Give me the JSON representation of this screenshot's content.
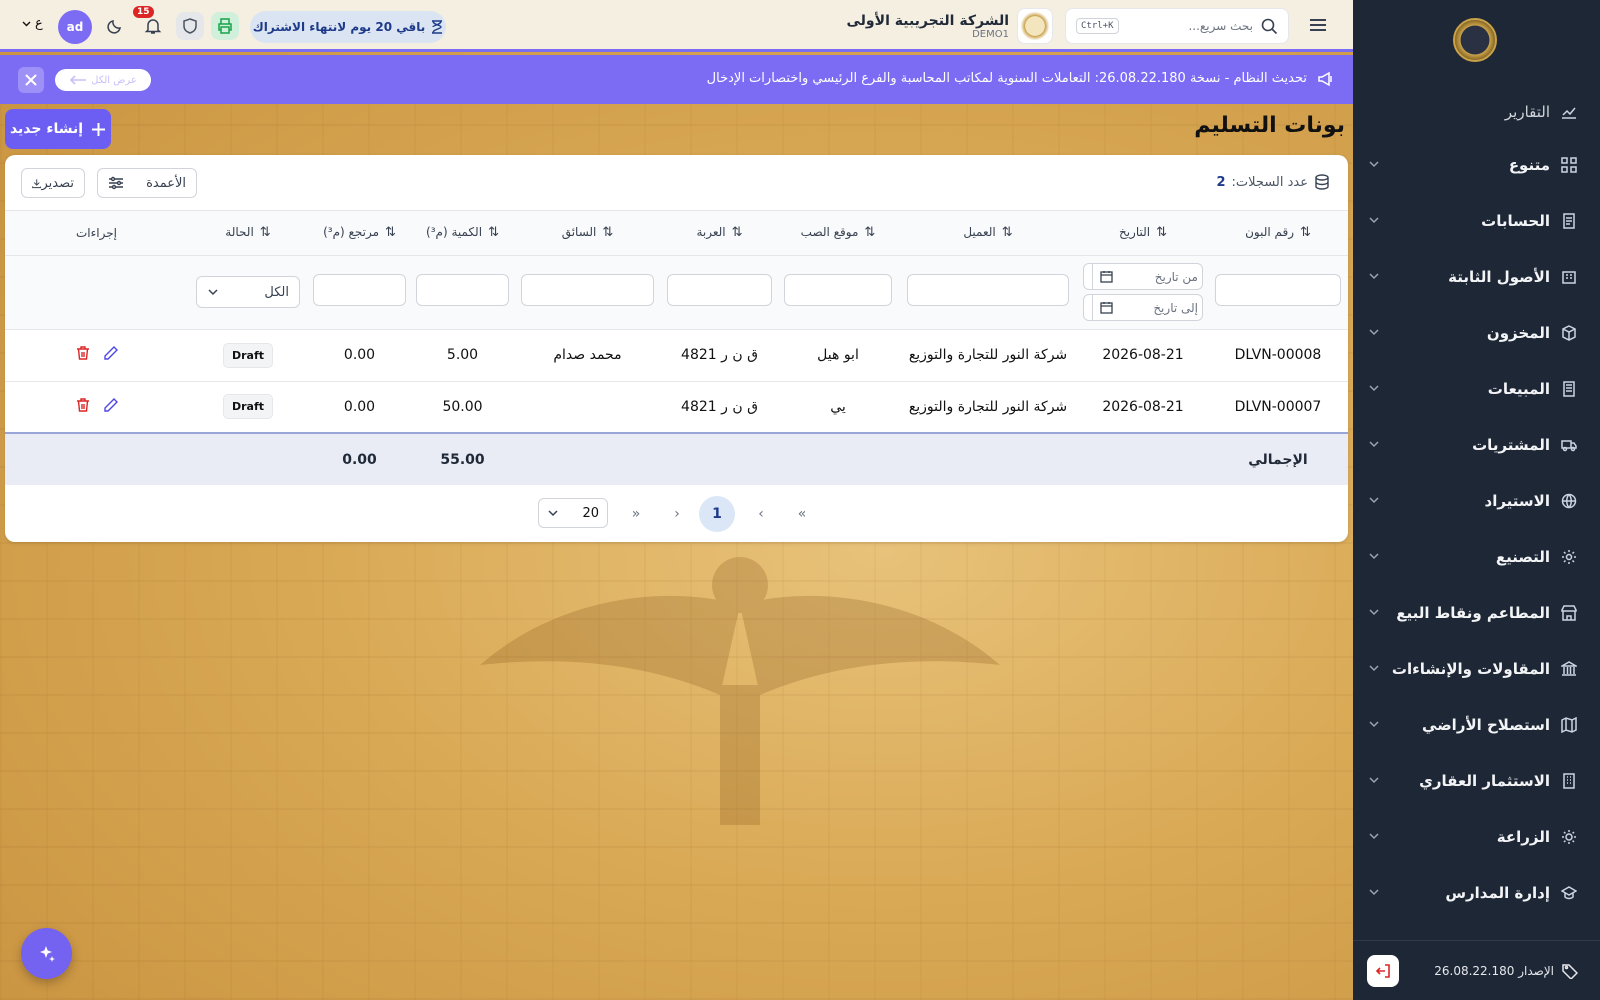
{
  "sidebar": {
    "items": [
      {
        "label": "التقارير",
        "icon": "chart-line-icon"
      },
      {
        "label": "متنوع",
        "icon": "grid-icon"
      },
      {
        "label": "الحسابات",
        "icon": "receipt-icon"
      },
      {
        "label": "الأصول الثابتة",
        "icon": "building-icon"
      },
      {
        "label": "المخزون",
        "icon": "box-icon"
      },
      {
        "label": "المبيعات",
        "icon": "invoice-icon"
      },
      {
        "label": "المشتريات",
        "icon": "truck-icon"
      },
      {
        "label": "الاستيراد",
        "icon": "globe-icon"
      },
      {
        "label": "التصنيع",
        "icon": "gear-icon"
      },
      {
        "label": "المطاعم ونقاط البيع",
        "icon": "store-icon"
      },
      {
        "label": "المقاولات والإنشاءات",
        "icon": "bank-icon"
      },
      {
        "label": "استصلاح الأراضي",
        "icon": "map-icon"
      },
      {
        "label": "الاستثمار العقاري",
        "icon": "office-icon"
      },
      {
        "label": "الزراعة",
        "icon": "sun-icon"
      },
      {
        "label": "إدارة المدارس",
        "icon": "graduation-icon"
      }
    ],
    "version_label": "الإصدار 26.08.22.180"
  },
  "topbar": {
    "search_placeholder": "بحث سريع...",
    "search_shortcut": "Ctrl+K",
    "company_name": "الشركة التجريبية الأولى",
    "company_code": "DEMO1",
    "subscription_badge": "باقي 20 يوم لانتهاء الاشتراك",
    "notifications_count": "15",
    "user_initials": "ad",
    "language": "ع"
  },
  "announcement": {
    "text": "تحديث النظام - نسخة 26.08.22.180: التعاملات السنوية لمكاتب المحاسبة والفرع الرئيسي واختصارات الإدخال",
    "pill_label": "عرض الكل"
  },
  "page": {
    "title": "بونات التسليم",
    "create_button": "إنشاء جديد"
  },
  "toolbar": {
    "records_label": "عدد السجلات:",
    "records_count": "2",
    "columns_button": "الأعمدة",
    "export_button": "تصدير"
  },
  "table": {
    "headers": [
      "رقم البون",
      "التاريخ",
      "العميل",
      "موقع الصب",
      "العربة",
      "السائق",
      "الكمية (م³)",
      "مرتجع (م³)",
      "الحالة",
      "إجراءات"
    ],
    "filters": {
      "date_from_placeholder": "من تاريخ",
      "date_to_placeholder": "إلى تاريخ",
      "status_value": "الكل"
    },
    "rows": [
      {
        "number": "DLVN-00008",
        "date": "2026-08-21",
        "customer": "شركة النور للتجارة والتوزيع",
        "site": "ابو هيل",
        "truck": "ق ن ر 4821",
        "driver": "محمد صدام",
        "qty": "5.00",
        "returned": "0.00",
        "status": "Draft"
      },
      {
        "number": "DLVN-00007",
        "date": "2026-08-21",
        "customer": "شركة النور للتجارة والتوزيع",
        "site": "يي",
        "truck": "ق ن ر 4821",
        "driver": "",
        "qty": "50.00",
        "returned": "0.00",
        "status": "Draft"
      }
    ],
    "totals": {
      "label": "الإجمالي",
      "qty": "55.00",
      "returned": "0.00"
    }
  },
  "pagination": {
    "current_page": "1",
    "page_size": "20"
  },
  "colors": {
    "accent": "#7c6cf4",
    "sidebar_bg": "#1e2736",
    "danger": "#dc2626"
  }
}
